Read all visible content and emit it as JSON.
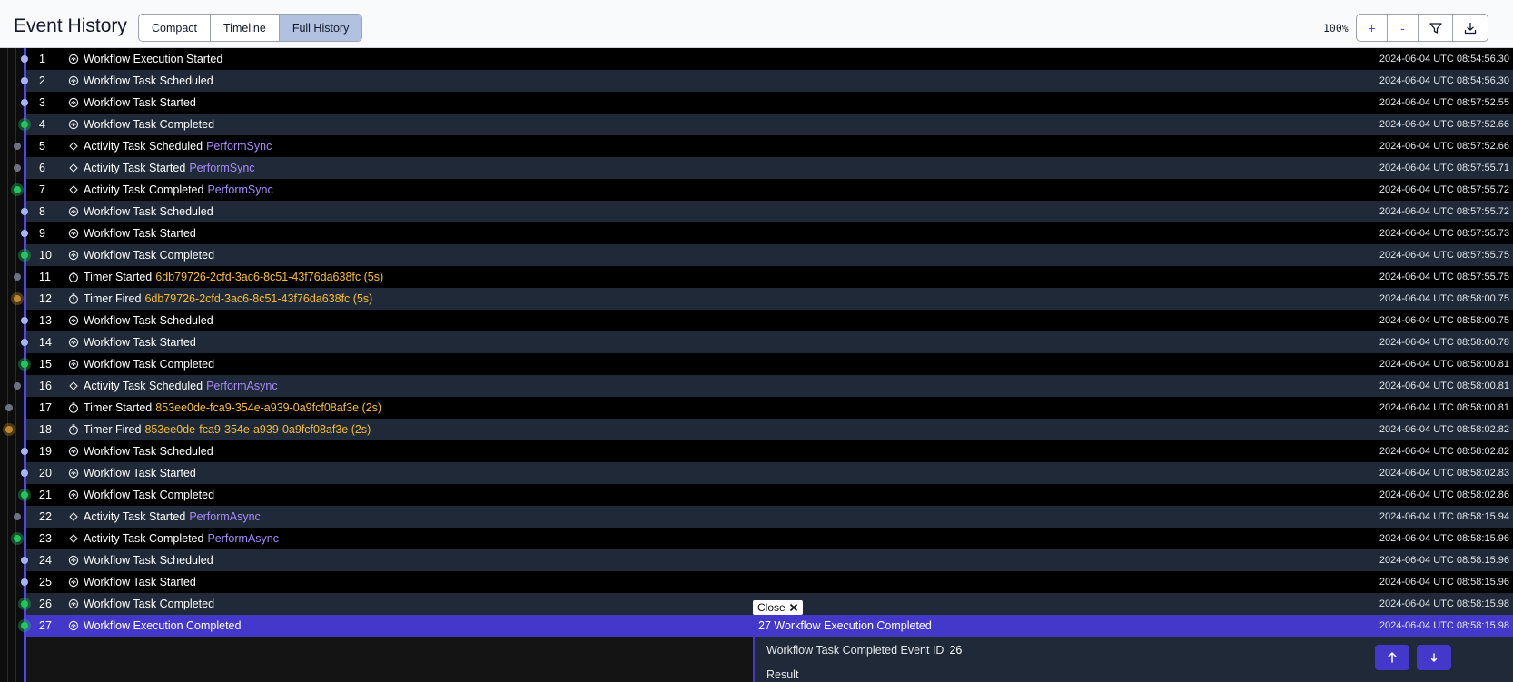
{
  "header": {
    "title": "Event History",
    "view_tabs": [
      "Compact",
      "Timeline",
      "Full History"
    ],
    "active_tab": "Full History",
    "zoom": "100%",
    "tools": [
      "+",
      "-",
      "filter-icon",
      "download-icon"
    ]
  },
  "events": [
    {
      "id": "1",
      "icon": "workflow",
      "name": "Workflow Execution Started",
      "detail": "",
      "time": "2024-06-04 UTC 08:54:56.30"
    },
    {
      "id": "2",
      "icon": "workflow",
      "name": "Workflow Task Scheduled",
      "detail": "",
      "time": "2024-06-04 UTC 08:54:56.30"
    },
    {
      "id": "3",
      "icon": "workflow",
      "name": "Workflow Task Started",
      "detail": "",
      "time": "2024-06-04 UTC 08:57:52.55"
    },
    {
      "id": "4",
      "icon": "workflow",
      "name": "Workflow Task Completed",
      "detail": "",
      "time": "2024-06-04 UTC 08:57:52.66"
    },
    {
      "id": "5",
      "icon": "activity",
      "name": "Activity Task Scheduled",
      "detail": "PerformSync",
      "time": "2024-06-04 UTC 08:57:52.66"
    },
    {
      "id": "6",
      "icon": "activity",
      "name": "Activity Task Started",
      "detail": "PerformSync",
      "time": "2024-06-04 UTC 08:57:55.71"
    },
    {
      "id": "7",
      "icon": "activity",
      "name": "Activity Task Completed",
      "detail": "PerformSync",
      "time": "2024-06-04 UTC 08:57:55.72"
    },
    {
      "id": "8",
      "icon": "workflow",
      "name": "Workflow Task Scheduled",
      "detail": "",
      "time": "2024-06-04 UTC 08:57:55.72"
    },
    {
      "id": "9",
      "icon": "workflow",
      "name": "Workflow Task Started",
      "detail": "",
      "time": "2024-06-04 UTC 08:57:55.73"
    },
    {
      "id": "10",
      "icon": "workflow",
      "name": "Workflow Task Completed",
      "detail": "",
      "time": "2024-06-04 UTC 08:57:55.75"
    },
    {
      "id": "11",
      "icon": "timer",
      "name": "Timer Started",
      "detail": "6db79726-2cfd-3ac6-8c51-43f76da638fc (5s)",
      "time": "2024-06-04 UTC 08:57:55.75"
    },
    {
      "id": "12",
      "icon": "timer",
      "name": "Timer Fired",
      "detail": "6db79726-2cfd-3ac6-8c51-43f76da638fc (5s)",
      "time": "2024-06-04 UTC 08:58:00.75"
    },
    {
      "id": "13",
      "icon": "workflow",
      "name": "Workflow Task Scheduled",
      "detail": "",
      "time": "2024-06-04 UTC 08:58:00.75"
    },
    {
      "id": "14",
      "icon": "workflow",
      "name": "Workflow Task Started",
      "detail": "",
      "time": "2024-06-04 UTC 08:58:00.78"
    },
    {
      "id": "15",
      "icon": "workflow",
      "name": "Workflow Task Completed",
      "detail": "",
      "time": "2024-06-04 UTC 08:58:00.81"
    },
    {
      "id": "16",
      "icon": "activity",
      "name": "Activity Task Scheduled",
      "detail": "PerformAsync",
      "time": "2024-06-04 UTC 08:58:00.81"
    },
    {
      "id": "17",
      "icon": "timer",
      "name": "Timer Started",
      "detail": "853ee0de-fca9-354e-a939-0a9fcf08af3e (2s)",
      "time": "2024-06-04 UTC 08:58:00.81"
    },
    {
      "id": "18",
      "icon": "timer",
      "name": "Timer Fired",
      "detail": "853ee0de-fca9-354e-a939-0a9fcf08af3e (2s)",
      "time": "2024-06-04 UTC 08:58:02.82"
    },
    {
      "id": "19",
      "icon": "workflow",
      "name": "Workflow Task Scheduled",
      "detail": "",
      "time": "2024-06-04 UTC 08:58:02.82"
    },
    {
      "id": "20",
      "icon": "workflow",
      "name": "Workflow Task Started",
      "detail": "",
      "time": "2024-06-04 UTC 08:58:02.83"
    },
    {
      "id": "21",
      "icon": "workflow",
      "name": "Workflow Task Completed",
      "detail": "",
      "time": "2024-06-04 UTC 08:58:02.86"
    },
    {
      "id": "22",
      "icon": "activity",
      "name": "Activity Task Started",
      "detail": "PerformAsync",
      "time": "2024-06-04 UTC 08:58:15.94"
    },
    {
      "id": "23",
      "icon": "activity",
      "name": "Activity Task Completed",
      "detail": "PerformAsync",
      "time": "2024-06-04 UTC 08:58:15.96"
    },
    {
      "id": "24",
      "icon": "workflow",
      "name": "Workflow Task Scheduled",
      "detail": "",
      "time": "2024-06-04 UTC 08:58:15.96"
    },
    {
      "id": "25",
      "icon": "workflow",
      "name": "Workflow Task Started",
      "detail": "",
      "time": "2024-06-04 UTC 08:58:15.96"
    },
    {
      "id": "26",
      "icon": "workflow",
      "name": "Workflow Task Completed",
      "detail": "",
      "time": "2024-06-04 UTC 08:58:15.98"
    },
    {
      "id": "27",
      "icon": "workflow",
      "name": "Workflow Execution Completed",
      "detail": "",
      "time": "2024-06-04 UTC 08:58:15.98"
    }
  ],
  "selected_event": "27",
  "details_panel": {
    "close_label": "Close",
    "title": "27 Workflow Execution Completed",
    "time": "2024-06-04 UTC 08:58:15.98",
    "field_label": "Workflow Task Completed Event ID",
    "field_value": "26",
    "result_label": "Result"
  },
  "colors": {
    "accent": "#4338ca",
    "activity_detail": "#a78bfa",
    "timer_detail": "#fbbf24",
    "completed_dot": "#22c55e",
    "timer_dot": "#c08a2a"
  }
}
